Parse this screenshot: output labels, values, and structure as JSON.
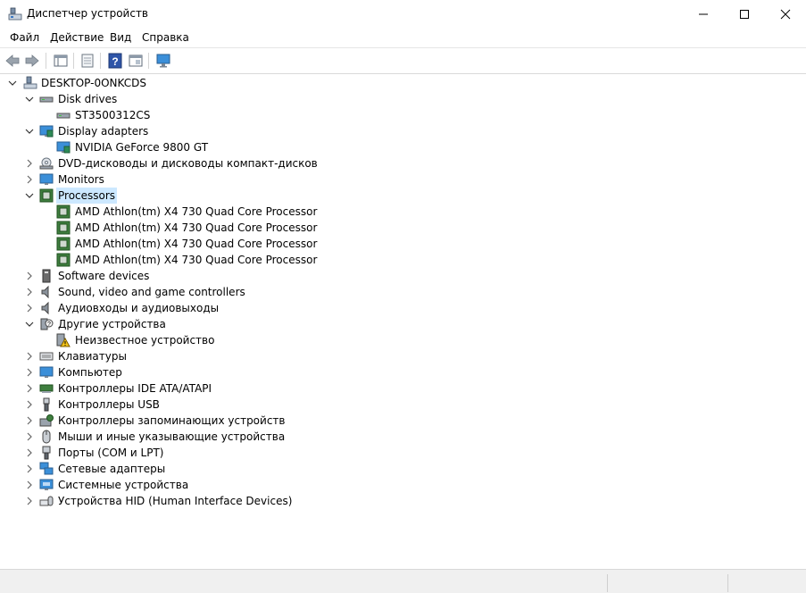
{
  "window": {
    "title": "Диспетчер устройств",
    "accent": "#0078d7"
  },
  "menu": [
    {
      "label": "Файл"
    },
    {
      "label": "Действие"
    },
    {
      "label": "Вид"
    },
    {
      "label": "Справка"
    }
  ],
  "toolbar": [
    "back-icon",
    "forward-icon",
    "properties-view-icon",
    "page-icon",
    "help-icon",
    "panel-icon",
    "monitor-scan-icon"
  ],
  "tree": {
    "root": "DESKTOP-0ONKCDS",
    "items": [
      {
        "label": "Disk drives",
        "expanded": true,
        "icon": "disk-drive-icon",
        "children": [
          "ST3500312CS"
        ]
      },
      {
        "label": "Display adapters",
        "expanded": true,
        "icon": "display-adapter-icon",
        "children": [
          "NVIDIA GeForce 9800 GT"
        ]
      },
      {
        "label": "DVD-дисководы и дисководы компакт-дисков",
        "expanded": false,
        "icon": "dvd-icon"
      },
      {
        "label": "Monitors",
        "expanded": false,
        "icon": "monitor-icon"
      },
      {
        "label": "Processors",
        "expanded": true,
        "selected": true,
        "icon": "processor-icon",
        "children": [
          "AMD Athlon(tm) X4 730 Quad Core Processor",
          "AMD Athlon(tm) X4 730 Quad Core Processor",
          "AMD Athlon(tm) X4 730 Quad Core Processor",
          "AMD Athlon(tm) X4 730 Quad Core Processor"
        ]
      },
      {
        "label": "Software devices",
        "expanded": false,
        "icon": "software-device-icon"
      },
      {
        "label": "Sound, video and game controllers",
        "expanded": false,
        "icon": "speaker-icon"
      },
      {
        "label": "Аудиовходы и аудиовыходы",
        "expanded": false,
        "icon": "speaker-icon"
      },
      {
        "label": "Другие устройства",
        "expanded": true,
        "icon": "other-device-icon",
        "children": [
          "Неизвестное устройство"
        ]
      },
      {
        "label": "Клавиатуры",
        "expanded": false,
        "icon": "keyboard-icon"
      },
      {
        "label": "Компьютер",
        "expanded": false,
        "icon": "computer-icon"
      },
      {
        "label": "Контроллеры IDE ATA/ATAPI",
        "expanded": false,
        "icon": "ide-controller-icon"
      },
      {
        "label": "Контроллеры USB",
        "expanded": false,
        "icon": "usb-icon"
      },
      {
        "label": "Контроллеры запоминающих устройств",
        "expanded": false,
        "icon": "storage-controller-icon"
      },
      {
        "label": "Мыши и иные указывающие устройства",
        "expanded": false,
        "icon": "mouse-icon"
      },
      {
        "label": "Порты (COM и LPT)",
        "expanded": false,
        "icon": "port-icon"
      },
      {
        "label": "Сетевые адаптеры",
        "expanded": false,
        "icon": "network-adapter-icon"
      },
      {
        "label": "Системные устройства",
        "expanded": false,
        "icon": "system-device-icon"
      },
      {
        "label": "Устройства HID (Human Interface Devices)",
        "expanded": false,
        "icon": "hid-icon"
      }
    ]
  }
}
